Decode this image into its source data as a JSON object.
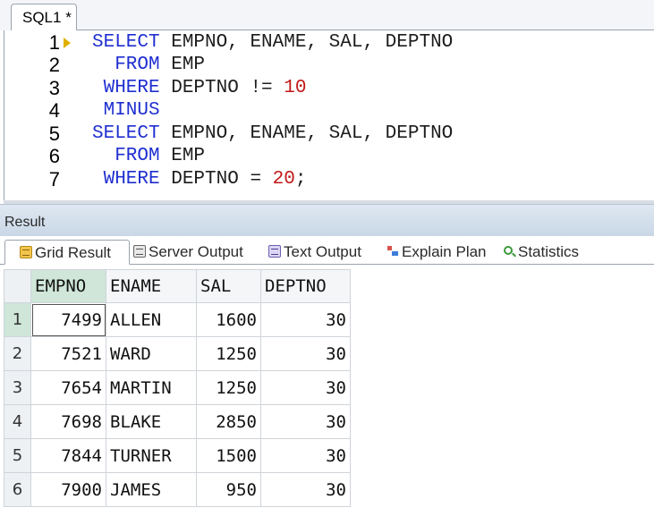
{
  "editor": {
    "tab_title": "SQL1 *",
    "line_numbers": [
      "1",
      "2",
      "3",
      "4",
      "5",
      "6",
      "7"
    ],
    "lines": [
      {
        "kw": "SELECT",
        "rest": " EMPNO, ENAME, SAL, DEPTNO",
        "num": "",
        "tail": ""
      },
      {
        "kw": "  FROM",
        "rest": " EMP",
        "num": "",
        "tail": ""
      },
      {
        "kw": " WHERE",
        "rest": " DEPTNO != ",
        "num": "10",
        "tail": ""
      },
      {
        "kw": " MINUS",
        "rest": "",
        "num": "",
        "tail": ""
      },
      {
        "kw": "SELECT",
        "rest": " EMPNO, ENAME, SAL, DEPTNO",
        "num": "",
        "tail": ""
      },
      {
        "kw": "  FROM",
        "rest": " EMP",
        "num": "",
        "tail": ""
      },
      {
        "kw": " WHERE",
        "rest": " DEPTNO = ",
        "num": "20",
        "tail": ";"
      }
    ]
  },
  "result": {
    "title": "Result",
    "tabs": [
      {
        "label": "Grid Result",
        "icon": "grid-icon"
      },
      {
        "label": "Server Output",
        "icon": "server-output-icon"
      },
      {
        "label": "Text Output",
        "icon": "text-output-icon"
      },
      {
        "label": "Explain Plan",
        "icon": "explain-plan-icon"
      },
      {
        "label": "Statistics",
        "icon": "statistics-icon"
      }
    ],
    "active_tab": "Grid Result",
    "columns": [
      "EMPNO",
      "ENAME",
      "SAL",
      "DEPTNO"
    ],
    "rows": [
      {
        "n": "1",
        "empno": "7499",
        "ename": "ALLEN",
        "sal": "1600",
        "deptno": "30"
      },
      {
        "n": "2",
        "empno": "7521",
        "ename": "WARD",
        "sal": "1250",
        "deptno": "30"
      },
      {
        "n": "3",
        "empno": "7654",
        "ename": "MARTIN",
        "sal": "1250",
        "deptno": "30"
      },
      {
        "n": "4",
        "empno": "7698",
        "ename": "BLAKE",
        "sal": "2850",
        "deptno": "30"
      },
      {
        "n": "5",
        "empno": "7844",
        "ename": "TURNER",
        "sal": "1500",
        "deptno": "30"
      },
      {
        "n": "6",
        "empno": "7900",
        "ename": "JAMES",
        "sal": "950",
        "deptno": "30"
      }
    ]
  },
  "colors": {
    "keyword": "#1f2fd0",
    "number": "#c21818",
    "selected_header": "#cfe6d9",
    "result_header": "#c9d7e6"
  }
}
